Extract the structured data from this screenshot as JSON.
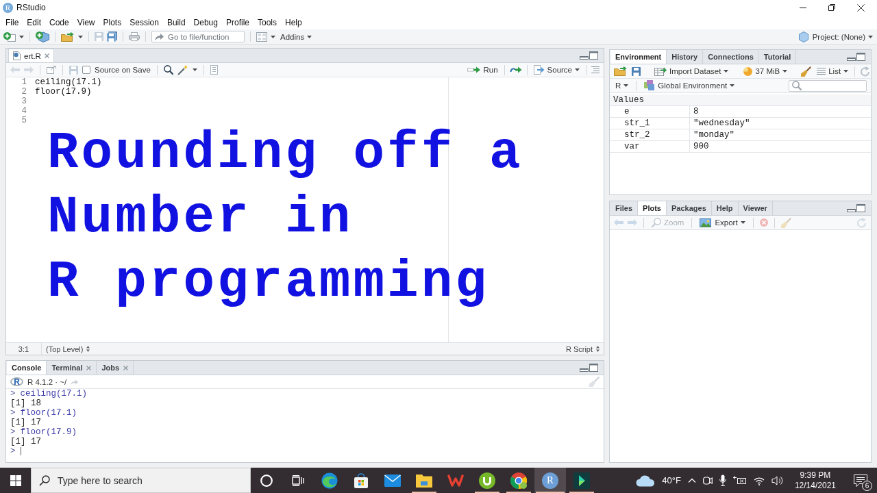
{
  "window": {
    "logo": "R",
    "title": "RStudio"
  },
  "menu": [
    "File",
    "Edit",
    "Code",
    "View",
    "Plots",
    "Session",
    "Build",
    "Debug",
    "Profile",
    "Tools",
    "Help"
  ],
  "toolbar": {
    "goto": {
      "placeholder": "Go to file/function"
    },
    "addins": "Addins",
    "project": "Project: (None)"
  },
  "editor": {
    "tabs": [
      {
        "label": "ert.R",
        "selected": true
      }
    ],
    "source_on_save": {
      "label": "Source on Save",
      "checked": false
    },
    "run": "Run",
    "source": "Source",
    "lines": [
      {
        "number": "1",
        "code": "ceiling(17.1)"
      },
      {
        "number": "2",
        "code": "floor(17.9)"
      },
      {
        "number": "3"
      },
      {
        "number": "4"
      },
      {
        "number": "5"
      }
    ],
    "title_lines": [
      "Rounding off a",
      "Number in",
      "R programming"
    ],
    "status": {
      "position": "3:1",
      "scope": "(Top Level)",
      "file_type": "R Script"
    }
  },
  "console": {
    "tabs": [
      {
        "label": "Console",
        "selected": true,
        "closable": false
      },
      {
        "label": "Terminal",
        "selected": false,
        "closable": true
      },
      {
        "label": "Jobs",
        "selected": false,
        "closable": true
      }
    ],
    "logo": "R",
    "session": "R 4.1.2 · ~/",
    "lines": [
      {
        "kind": "input",
        "prompt": ">",
        "text": "ceiling(17.1)"
      },
      {
        "kind": "output",
        "text": "[1] 18"
      },
      {
        "kind": "input",
        "prompt": ">",
        "text": "floor(17.1)"
      },
      {
        "kind": "output",
        "text": "[1] 17"
      },
      {
        "kind": "input",
        "prompt": ">",
        "text": "floor(17.9)"
      },
      {
        "kind": "output",
        "text": "[1] 17"
      },
      {
        "kind": "prompt",
        "prompt": ">"
      }
    ]
  },
  "environment": {
    "tabs": [
      {
        "label": "Environment",
        "selected": true
      },
      {
        "label": "History",
        "selected": false
      },
      {
        "label": "Connections",
        "selected": false
      },
      {
        "label": "Tutorial",
        "selected": false
      }
    ],
    "import": "Import Dataset",
    "memory": "37 MiB",
    "view": "List",
    "language": "R",
    "scope": "Global Environment",
    "section": "Values",
    "rows": [
      {
        "name": "e",
        "value": "8"
      },
      {
        "name": "str_1",
        "value": "\"wednesday\""
      },
      {
        "name": "str_2",
        "value": "\"monday\""
      },
      {
        "name": "var",
        "value": "900"
      }
    ]
  },
  "files": {
    "tabs": [
      {
        "label": "Files",
        "selected": false
      },
      {
        "label": "Plots",
        "selected": true
      },
      {
        "label": "Packages",
        "selected": false
      },
      {
        "label": "Help",
        "selected": false
      },
      {
        "label": "Viewer",
        "selected": false
      }
    ],
    "zoom": {
      "label": "Zoom",
      "disabled": true
    },
    "export": {
      "label": "Export",
      "disabled": false
    }
  },
  "taskbar": {
    "search": {
      "placeholder": "Type here to search"
    },
    "apps": [
      {
        "kind": "edge",
        "running": false,
        "active": false
      },
      {
        "kind": "store",
        "running": false,
        "active": false
      },
      {
        "kind": "mail",
        "running": false,
        "active": false
      },
      {
        "kind": "explorer",
        "running": true,
        "active": false
      },
      {
        "kind": "wps",
        "running": false,
        "active": false
      },
      {
        "kind": "utorrent",
        "running": true,
        "active": false
      },
      {
        "kind": "chrome",
        "running": true,
        "active": false
      },
      {
        "kind": "r",
        "letter": "R",
        "running": true,
        "active": true
      },
      {
        "kind": "filmora",
        "running": true,
        "active": false
      }
    ],
    "weather": "40°F",
    "time": "9:39 PM",
    "date": "12/14/2021",
    "notifications": "6"
  }
}
